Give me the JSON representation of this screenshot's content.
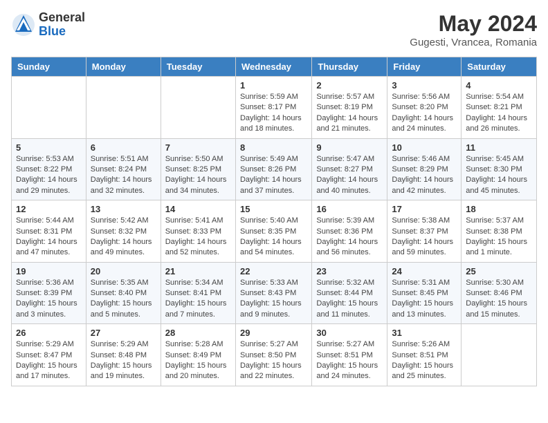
{
  "logo": {
    "general": "General",
    "blue": "Blue"
  },
  "title": "May 2024",
  "location": "Gugesti, Vrancea, Romania",
  "weekdays": [
    "Sunday",
    "Monday",
    "Tuesday",
    "Wednesday",
    "Thursday",
    "Friday",
    "Saturday"
  ],
  "weeks": [
    [
      {
        "day": "",
        "info": ""
      },
      {
        "day": "",
        "info": ""
      },
      {
        "day": "",
        "info": ""
      },
      {
        "day": "1",
        "info": "Sunrise: 5:59 AM\nSunset: 8:17 PM\nDaylight: 14 hours\nand 18 minutes."
      },
      {
        "day": "2",
        "info": "Sunrise: 5:57 AM\nSunset: 8:19 PM\nDaylight: 14 hours\nand 21 minutes."
      },
      {
        "day": "3",
        "info": "Sunrise: 5:56 AM\nSunset: 8:20 PM\nDaylight: 14 hours\nand 24 minutes."
      },
      {
        "day": "4",
        "info": "Sunrise: 5:54 AM\nSunset: 8:21 PM\nDaylight: 14 hours\nand 26 minutes."
      }
    ],
    [
      {
        "day": "5",
        "info": "Sunrise: 5:53 AM\nSunset: 8:22 PM\nDaylight: 14 hours\nand 29 minutes."
      },
      {
        "day": "6",
        "info": "Sunrise: 5:51 AM\nSunset: 8:24 PM\nDaylight: 14 hours\nand 32 minutes."
      },
      {
        "day": "7",
        "info": "Sunrise: 5:50 AM\nSunset: 8:25 PM\nDaylight: 14 hours\nand 34 minutes."
      },
      {
        "day": "8",
        "info": "Sunrise: 5:49 AM\nSunset: 8:26 PM\nDaylight: 14 hours\nand 37 minutes."
      },
      {
        "day": "9",
        "info": "Sunrise: 5:47 AM\nSunset: 8:27 PM\nDaylight: 14 hours\nand 40 minutes."
      },
      {
        "day": "10",
        "info": "Sunrise: 5:46 AM\nSunset: 8:29 PM\nDaylight: 14 hours\nand 42 minutes."
      },
      {
        "day": "11",
        "info": "Sunrise: 5:45 AM\nSunset: 8:30 PM\nDaylight: 14 hours\nand 45 minutes."
      }
    ],
    [
      {
        "day": "12",
        "info": "Sunrise: 5:44 AM\nSunset: 8:31 PM\nDaylight: 14 hours\nand 47 minutes."
      },
      {
        "day": "13",
        "info": "Sunrise: 5:42 AM\nSunset: 8:32 PM\nDaylight: 14 hours\nand 49 minutes."
      },
      {
        "day": "14",
        "info": "Sunrise: 5:41 AM\nSunset: 8:33 PM\nDaylight: 14 hours\nand 52 minutes."
      },
      {
        "day": "15",
        "info": "Sunrise: 5:40 AM\nSunset: 8:35 PM\nDaylight: 14 hours\nand 54 minutes."
      },
      {
        "day": "16",
        "info": "Sunrise: 5:39 AM\nSunset: 8:36 PM\nDaylight: 14 hours\nand 56 minutes."
      },
      {
        "day": "17",
        "info": "Sunrise: 5:38 AM\nSunset: 8:37 PM\nDaylight: 14 hours\nand 59 minutes."
      },
      {
        "day": "18",
        "info": "Sunrise: 5:37 AM\nSunset: 8:38 PM\nDaylight: 15 hours\nand 1 minute."
      }
    ],
    [
      {
        "day": "19",
        "info": "Sunrise: 5:36 AM\nSunset: 8:39 PM\nDaylight: 15 hours\nand 3 minutes."
      },
      {
        "day": "20",
        "info": "Sunrise: 5:35 AM\nSunset: 8:40 PM\nDaylight: 15 hours\nand 5 minutes."
      },
      {
        "day": "21",
        "info": "Sunrise: 5:34 AM\nSunset: 8:41 PM\nDaylight: 15 hours\nand 7 minutes."
      },
      {
        "day": "22",
        "info": "Sunrise: 5:33 AM\nSunset: 8:43 PM\nDaylight: 15 hours\nand 9 minutes."
      },
      {
        "day": "23",
        "info": "Sunrise: 5:32 AM\nSunset: 8:44 PM\nDaylight: 15 hours\nand 11 minutes."
      },
      {
        "day": "24",
        "info": "Sunrise: 5:31 AM\nSunset: 8:45 PM\nDaylight: 15 hours\nand 13 minutes."
      },
      {
        "day": "25",
        "info": "Sunrise: 5:30 AM\nSunset: 8:46 PM\nDaylight: 15 hours\nand 15 minutes."
      }
    ],
    [
      {
        "day": "26",
        "info": "Sunrise: 5:29 AM\nSunset: 8:47 PM\nDaylight: 15 hours\nand 17 minutes."
      },
      {
        "day": "27",
        "info": "Sunrise: 5:29 AM\nSunset: 8:48 PM\nDaylight: 15 hours\nand 19 minutes."
      },
      {
        "day": "28",
        "info": "Sunrise: 5:28 AM\nSunset: 8:49 PM\nDaylight: 15 hours\nand 20 minutes."
      },
      {
        "day": "29",
        "info": "Sunrise: 5:27 AM\nSunset: 8:50 PM\nDaylight: 15 hours\nand 22 minutes."
      },
      {
        "day": "30",
        "info": "Sunrise: 5:27 AM\nSunset: 8:51 PM\nDaylight: 15 hours\nand 24 minutes."
      },
      {
        "day": "31",
        "info": "Sunrise: 5:26 AM\nSunset: 8:51 PM\nDaylight: 15 hours\nand 25 minutes."
      },
      {
        "day": "",
        "info": ""
      }
    ]
  ]
}
